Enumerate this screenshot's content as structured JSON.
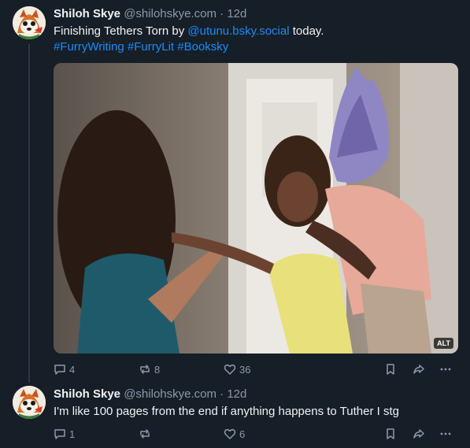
{
  "posts": [
    {
      "author": "Shiloh Skye",
      "handle": "@shilohskye.com",
      "separator": "·",
      "time": "12d",
      "text_before": "Finishing Tethers Torn by ",
      "mention": "@utunu.bsky.social",
      "text_after": " today.",
      "hashtags": "#FurryWriting #FurryLit #Booksky",
      "image_alt_badge": "ALT",
      "reply_count": "4",
      "repost_count": "8",
      "like_count": "36"
    },
    {
      "author": "Shiloh Skye",
      "handle": "@shilohskye.com",
      "separator": "·",
      "time": "12d",
      "text": "I'm like 100 pages from the end if anything happens to Tuther I stg",
      "reply_count": "1",
      "repost_count": "",
      "like_count": "6"
    }
  ],
  "icons": {
    "reply": "reply-icon",
    "repost": "repost-icon",
    "like": "heart-icon",
    "bookmark": "bookmark-icon",
    "share": "share-icon",
    "more": "more-icon"
  },
  "colors": {
    "background": "#161e27",
    "link": "#1d8cf5",
    "muted": "#8d9aab"
  }
}
